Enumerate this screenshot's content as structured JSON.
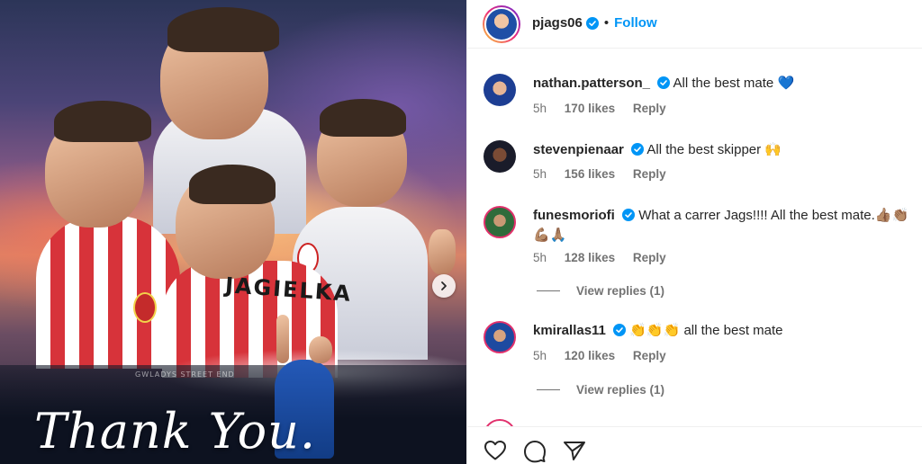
{
  "media": {
    "jersey_text": "JAGIELKA",
    "banner_text": "GWLADYS STREET END",
    "caption": "Thank You.",
    "next_icon": "chevron-right-icon"
  },
  "header": {
    "username": "pjags06",
    "separator": "•",
    "follow_label": "Follow"
  },
  "comments": [
    {
      "username": "nathan.patterson_",
      "text": "All the best mate 💙",
      "time": "5h",
      "likes": "170 likes",
      "reply": "Reply"
    },
    {
      "username": "stevenpienaar",
      "text": "All the best skipper 🙌",
      "time": "5h",
      "likes": "156 likes",
      "reply": "Reply"
    },
    {
      "username": "funesmoriofi",
      "text": "What a carrer Jags!!!! All the best mate.👍🏽👏🏽💪🏽🙏🏽",
      "time": "5h",
      "likes": "128 likes",
      "reply": "Reply",
      "view_replies": "View replies (1)"
    },
    {
      "username": "kmirallas11",
      "text": "👏👏👏 all the best mate",
      "time": "5h",
      "likes": "120 likes",
      "reply": "Reply",
      "view_replies": "View replies (1)"
    }
  ],
  "actions": {
    "like_icon": "heart-icon",
    "comment_icon": "comment-icon",
    "share_icon": "share-icon"
  },
  "colors": {
    "link_blue": "#0095f6",
    "verified_blue": "#0095f6",
    "meta_gray": "#737373"
  }
}
